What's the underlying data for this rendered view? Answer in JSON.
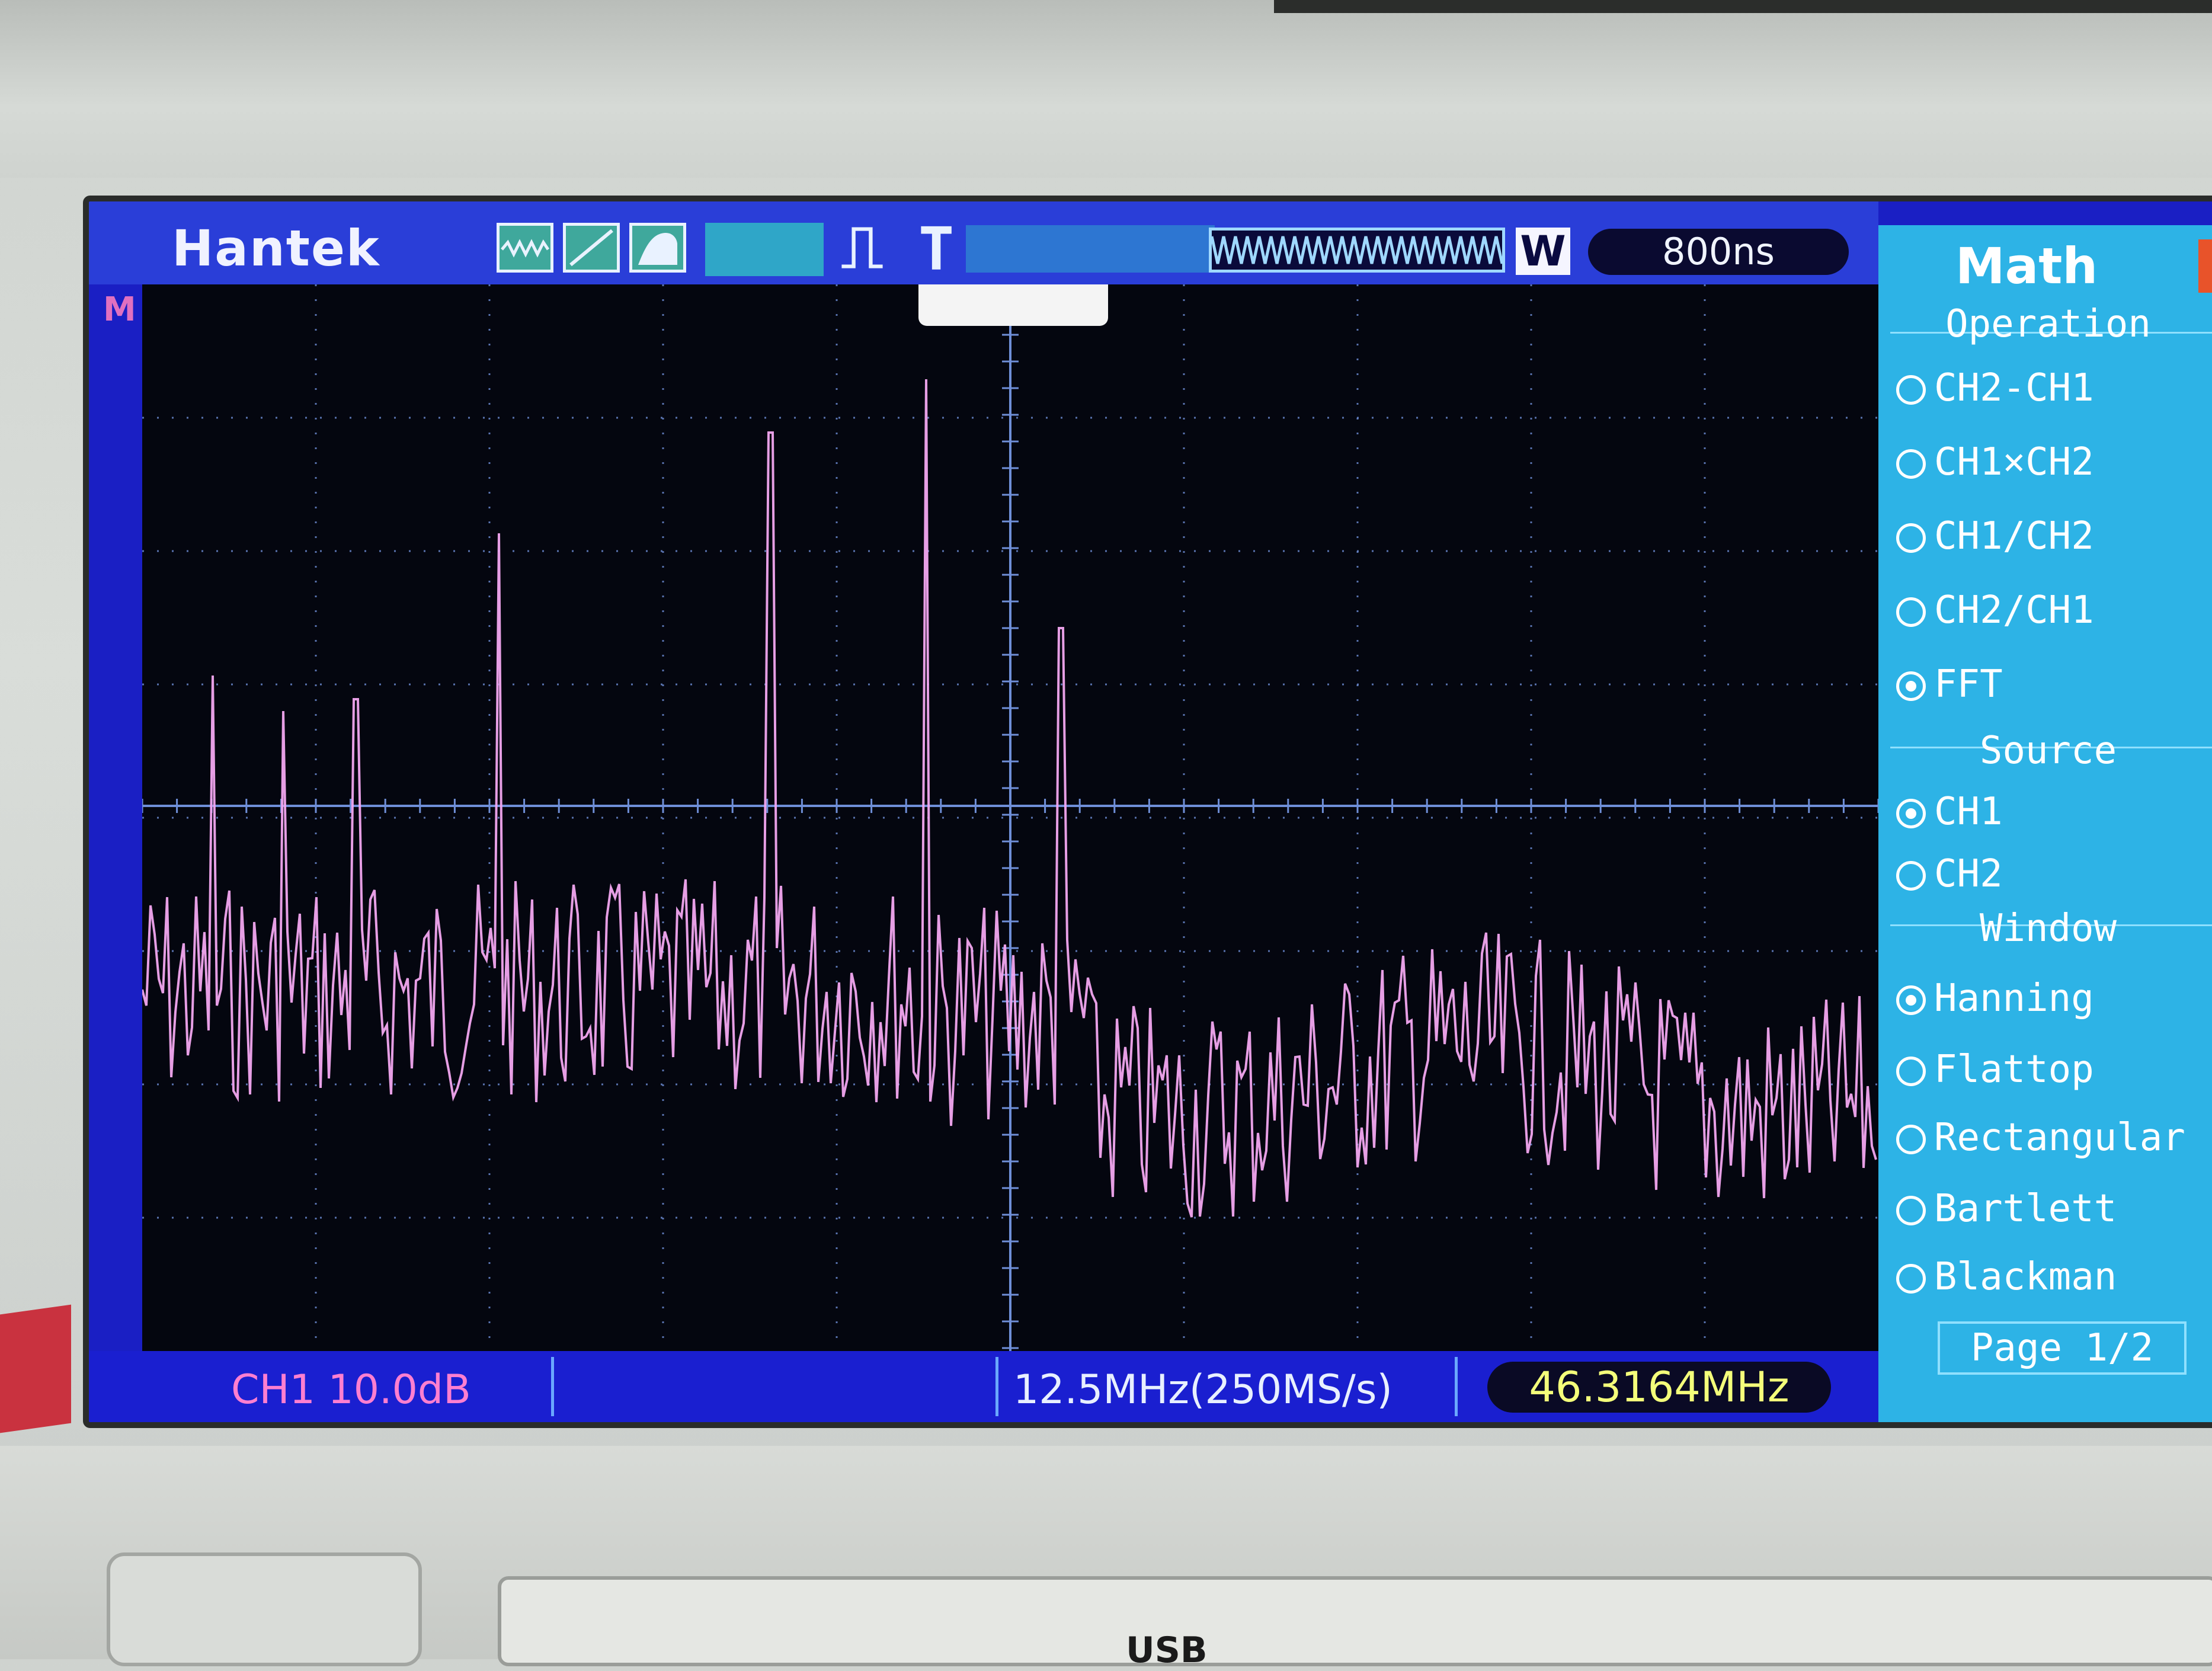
{
  "device": {
    "brand": "Hantek",
    "usb_label": "USB"
  },
  "topbar": {
    "icons": [
      "waveform-icon",
      "ramp-icon",
      "fill-icon",
      "trigger-edge-icon",
      "record-length-icon"
    ],
    "trigger_letter": "T",
    "w_badge": "W",
    "timebase": "800ns"
  },
  "bottombar": {
    "channel_scale": "CH1 10.0dB",
    "span": "12.5MHz(250MS/s)",
    "frequency": "46.3164MHz"
  },
  "menu": {
    "title": "Math",
    "operation": {
      "label": "Operation",
      "options": [
        "CH2-CH1",
        "CH1×CH2",
        "CH1/CH2",
        "CH2/CH1",
        "FFT"
      ],
      "selected": "FFT"
    },
    "source": {
      "label": "Source",
      "options": [
        "CH1",
        "CH2"
      ],
      "selected": "CH1"
    },
    "window": {
      "label": "Window",
      "options": [
        "Hanning",
        "Flattop",
        "Rectangular",
        "Bartlett",
        "Blackman"
      ],
      "selected": "Hanning"
    },
    "page": "Page 1/2"
  },
  "colors": {
    "trace": "#f2a6f0",
    "grid": "#6f8fd8",
    "screen_blue": "#1a1fc4",
    "menu_blue": "#2db3e6",
    "readout_yellow": "#f4ff7a",
    "ch1_pink": "#ff7fd0"
  }
}
